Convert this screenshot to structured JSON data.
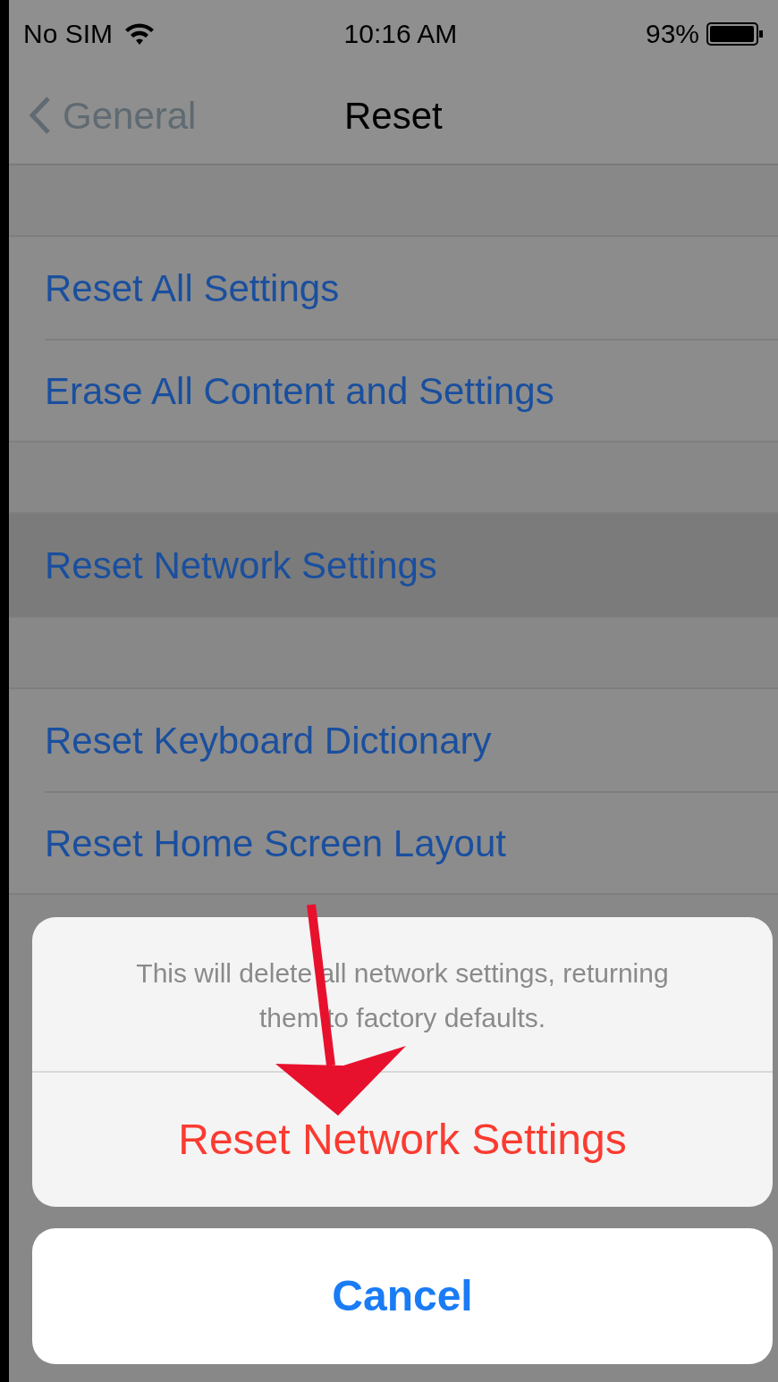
{
  "status_bar": {
    "carrier": "No SIM",
    "time": "10:16 AM",
    "battery": "93%"
  },
  "nav": {
    "back": "General",
    "title": "Reset"
  },
  "sections": [
    {
      "rows": [
        {
          "label": "Reset All Settings",
          "selected": false
        },
        {
          "label": "Erase All Content and Settings",
          "selected": false
        }
      ]
    },
    {
      "rows": [
        {
          "label": "Reset Network Settings",
          "selected": true
        }
      ]
    },
    {
      "rows": [
        {
          "label": "Reset Keyboard Dictionary",
          "selected": false
        },
        {
          "label": "Reset Home Screen Layout",
          "selected": false
        }
      ]
    }
  ],
  "action_sheet": {
    "message": "This will delete all network settings, returning them to factory defaults.",
    "destructive": "Reset Network Settings",
    "cancel": "Cancel"
  }
}
